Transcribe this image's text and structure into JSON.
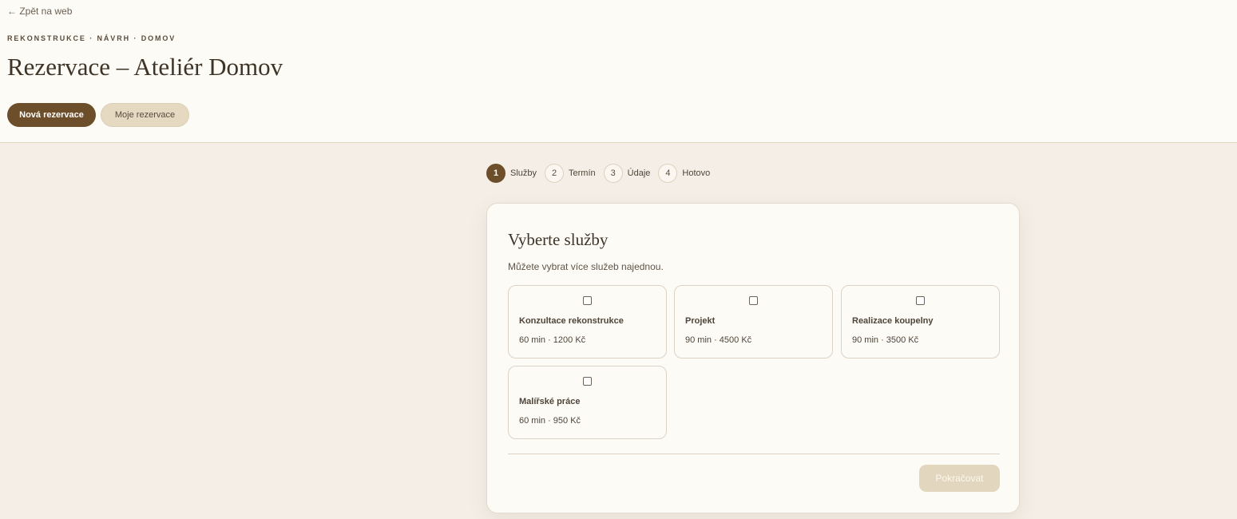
{
  "header": {
    "back_link": "← Zpět na web",
    "eyebrow": "REKONSTRUKCE · NÁVRH · DOMOV",
    "title": "Rezervace – Ateliér Domov",
    "buttons": {
      "new_reservation": "Nová rezervace",
      "my_reservations": "Moje rezervace"
    }
  },
  "stepper": {
    "steps": [
      {
        "num": "1",
        "label": "Služby",
        "active": true
      },
      {
        "num": "2",
        "label": "Termín",
        "active": false
      },
      {
        "num": "3",
        "label": "Údaje",
        "active": false
      },
      {
        "num": "4",
        "label": "Hotovo",
        "active": false
      }
    ]
  },
  "card": {
    "title": "Vyberte služby",
    "subtitle": "Můžete vybrat více služeb najednou.",
    "services": [
      {
        "name": "Konzultace rekonstrukce",
        "meta": "60 min · 1200 Kč",
        "checked": false
      },
      {
        "name": "Projekt",
        "meta": "90 min · 4500 Kč",
        "checked": false
      },
      {
        "name": "Realizace koupelny",
        "meta": "90 min · 3500 Kč",
        "checked": false
      },
      {
        "name": "Malířské práce",
        "meta": "60 min · 950 Kč",
        "checked": false
      }
    ],
    "continue_label": "Pokračovat"
  },
  "colors": {
    "accent": "#6c4e2b",
    "accent_light": "#e5d9c2",
    "background": "#f4eee6",
    "surface": "#fdfbf6"
  }
}
